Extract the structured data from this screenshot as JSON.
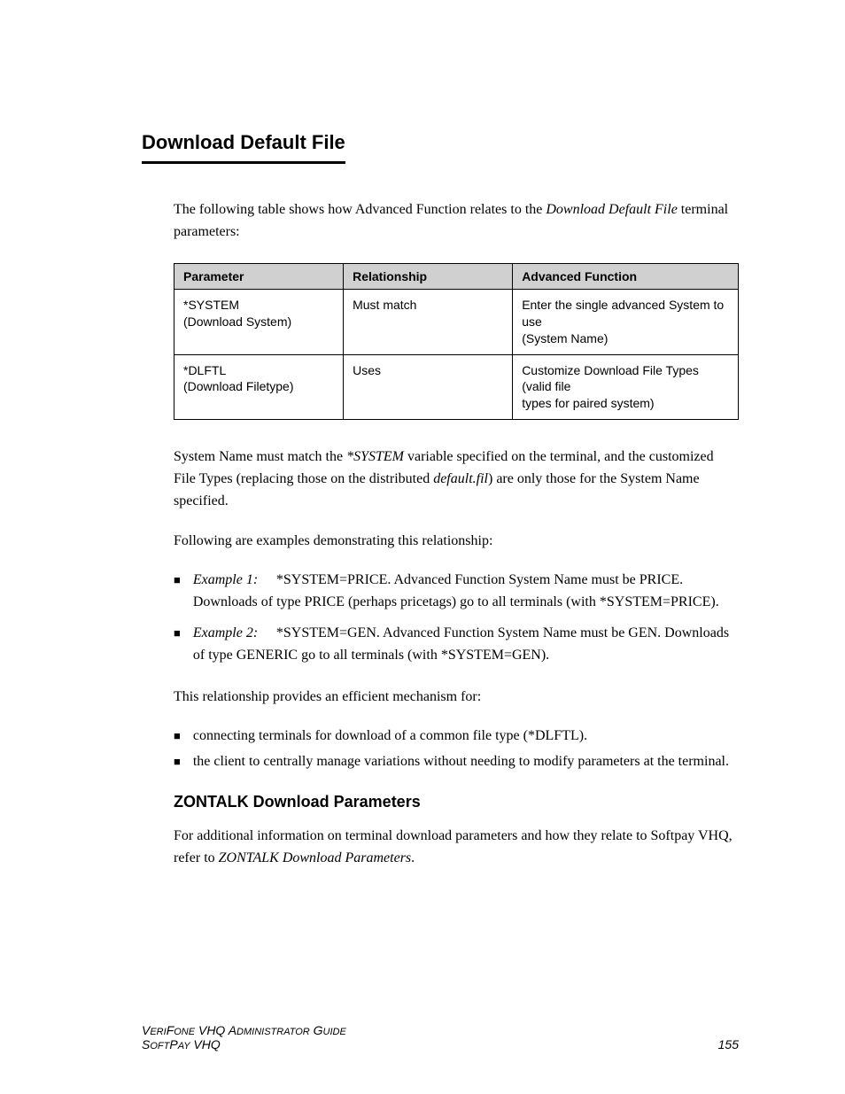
{
  "section": {
    "title": "Download Default File"
  },
  "intro": {
    "prefix": "The following table shows how Advanced Function relates to the ",
    "italic": "Download Default File",
    "suffix": " terminal parameters:"
  },
  "table": {
    "headers": [
      "Parameter",
      "Relationship",
      "Advanced Function"
    ],
    "rows": [
      [
        {
          "line1": "*SYSTEM",
          "line2": "(Download System)"
        },
        {
          "text": "Must match"
        },
        {
          "line1": "Enter the single advanced System to use",
          "line2": "(System Name)"
        }
      ],
      [
        {
          "line1": "*DLFTL",
          "line2": "(Download Filetype)"
        },
        {
          "text": "Uses"
        },
        {
          "line1": "Customize Download File Types (valid file",
          "line2": "types for paired system)"
        }
      ]
    ]
  },
  "paras": {
    "p1": {
      "prefix": "System Name must match the ",
      "i1": "*SYSTEM",
      "mid": " variable specified on the terminal, and the customized File Types (replacing those on the distributed ",
      "i2": "default.fil",
      "suffix": ") are only those for the System Name specified."
    },
    "p2": "Following are examples demonstrating this relationship:"
  },
  "examples": [
    {
      "label": "Example 1:",
      "text": "*SYSTEM=PRICE. Advanced Function System Name must be PRICE. Downloads of type PRICE (perhaps pricetags) go to all terminals (with *SYSTEM=PRICE)."
    },
    {
      "label": "Example 2:",
      "text": "*SYSTEM=GEN. Advanced Function System Name must be GEN. Downloads of type GENERIC go to all terminals (with *SYSTEM=GEN)."
    }
  ],
  "efficient": {
    "lead": "This relationship provides an efficient mechanism for:",
    "items": [
      "connecting terminals for download of a common file type (*DLFTL).",
      "the client to centrally manage variations without needing to modify parameters at the terminal."
    ]
  },
  "callout": {
    "title": "ZONTALK Download Parameters",
    "body_prefix": "For additional information on terminal download parameters and how they relate to Softpay VHQ, refer to ",
    "body_italic": "ZONTALK Download Parameters",
    "body_suffix": "."
  },
  "footer": {
    "left_top": "V",
    "left_top_small": "ERI",
    "left_top_rest": "F",
    "left_top_small2": "ONE",
    "left_top_trail": " VHQ A",
    "left_top_small3": "DMINISTRATOR",
    "left_top_trail2": " G",
    "left_top_small4": "UIDE",
    "left_bottom_prefix": "S",
    "left_bottom_small": "OFT",
    "left_bottom_mid": "P",
    "left_bottom_small2": "AY",
    "left_bottom_trail": " VHQ",
    "right": "155"
  }
}
